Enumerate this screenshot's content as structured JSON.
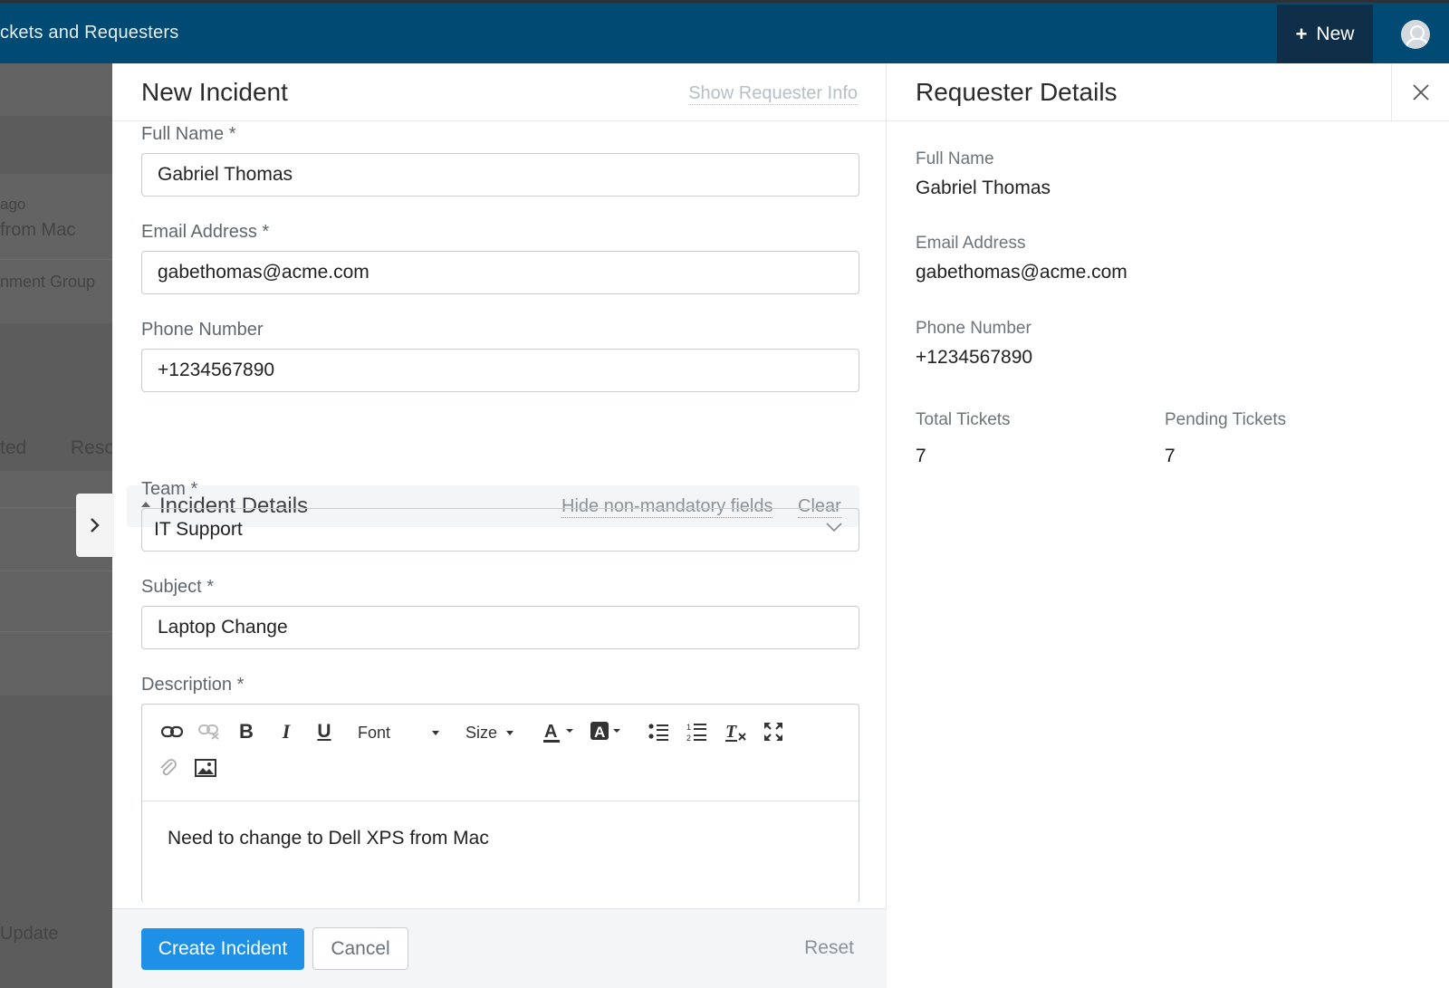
{
  "app": {
    "title": "ckets and Requesters",
    "new_button": "New"
  },
  "background": {
    "lines": [
      "ago",
      "from Mac",
      "nment Group",
      "ted",
      "Reso",
      "Update"
    ]
  },
  "form": {
    "title": "New Incident",
    "show_requester_link": "Show Requester Info",
    "full_name": {
      "label": "Full Name *",
      "value": "Gabriel Thomas"
    },
    "email": {
      "label": "Email Address *",
      "value": "gabethomas@acme.com"
    },
    "phone": {
      "label": "Phone Number",
      "value": "+1234567890"
    },
    "section": {
      "title": "Incident Details",
      "hide_link": "Hide non-mandatory fields",
      "clear_link": "Clear"
    },
    "team": {
      "label": "Team *",
      "value": "IT Support"
    },
    "subject": {
      "label": "Subject *",
      "value": "Laptop Change"
    },
    "description": {
      "label": "Description *",
      "font_dropdown": "Font",
      "size_dropdown": "Size",
      "body": "Need to change to Dell XPS from Mac"
    },
    "footer": {
      "create": "Create Incident",
      "cancel": "Cancel",
      "reset": "Reset"
    }
  },
  "requester": {
    "title": "Requester Details",
    "full_name_label": "Full Name",
    "full_name": "Gabriel Thomas",
    "email_label": "Email Address",
    "email": "gabethomas@acme.com",
    "phone_label": "Phone Number",
    "phone": "+1234567890",
    "total_label": "Total Tickets",
    "total": "7",
    "pending_label": "Pending Tickets",
    "pending": "7"
  },
  "colors": {
    "topbar": "#004a73",
    "new_button_bg": "#0e2f47",
    "primary": "#1e90e6"
  }
}
